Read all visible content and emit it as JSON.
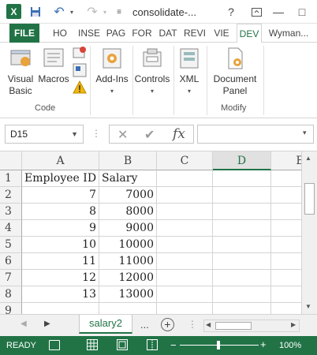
{
  "window": {
    "title": "consolidate-...",
    "help": "?",
    "restore_icon": "restore-icon",
    "minimize": "—",
    "maximize": "□"
  },
  "tabs": [
    "FILE",
    "HO",
    "INSE",
    "PAG",
    "FOR",
    "DAT",
    "REVI",
    "VIE",
    "DEV",
    "Wyman..."
  ],
  "ribbon": {
    "code_group": {
      "visual_basic": "Visual Basic",
      "macros": "Macros",
      "label": "Code"
    },
    "addins": "Add-Ins",
    "controls": "Controls",
    "xml": "XML",
    "modify_group": {
      "document_panel": "Document Panel",
      "label": "Modify"
    }
  },
  "formula_bar": {
    "name_box": "D15",
    "cancel": "✕",
    "enter": "✔",
    "fx": "fx",
    "value": ""
  },
  "grid": {
    "columns": [
      "A",
      "B",
      "C",
      "D",
      "E"
    ],
    "selected_column": "D",
    "rows": [
      {
        "num": "1",
        "a": "Employee ID",
        "b": "Salary"
      },
      {
        "num": "2",
        "a": "7",
        "b": "7000"
      },
      {
        "num": "3",
        "a": "8",
        "b": "8000"
      },
      {
        "num": "4",
        "a": "9",
        "b": "9000"
      },
      {
        "num": "5",
        "a": "10",
        "b": "10000"
      },
      {
        "num": "6",
        "a": "11",
        "b": "11000"
      },
      {
        "num": "7",
        "a": "12",
        "b": "12000"
      },
      {
        "num": "8",
        "a": "13",
        "b": "13000"
      },
      {
        "num": "9",
        "a": "",
        "b": ""
      }
    ]
  },
  "sheets": {
    "active": "salary2",
    "more": "...",
    "add": "+"
  },
  "status": {
    "text": "READY",
    "zoom": "100%",
    "zoom_minus": "−",
    "zoom_plus": "+"
  },
  "colors": {
    "accent": "#217346"
  }
}
